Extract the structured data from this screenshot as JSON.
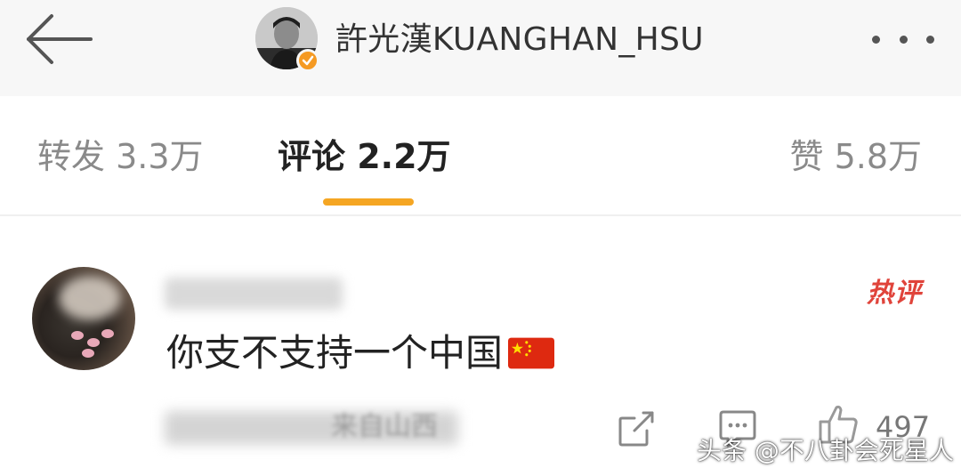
{
  "header": {
    "back_icon": "arrow-left-icon",
    "title": "許光漢KUANGHAN_HSU",
    "verified_icon": "verified-badge-icon",
    "more_icon": "more-dots-icon"
  },
  "tabs": [
    {
      "label": "转发 3.3万",
      "active": false
    },
    {
      "label": "评论 2.2万",
      "active": true
    },
    {
      "label": "赞 5.8万",
      "active": false
    }
  ],
  "colors": {
    "accent": "#f5a623",
    "hot": "#e0443b",
    "verified": "#f59a23"
  },
  "comment": {
    "hot_label": "热评",
    "text": "你支不支持一个中国",
    "flag_icon": "china-flag-icon",
    "location": "来自山西",
    "like_count": "497",
    "share_icon": "share-icon",
    "reply_icon": "comment-icon",
    "like_icon": "thumbs-up-icon"
  },
  "watermark": "头条 @不八卦会死星人"
}
